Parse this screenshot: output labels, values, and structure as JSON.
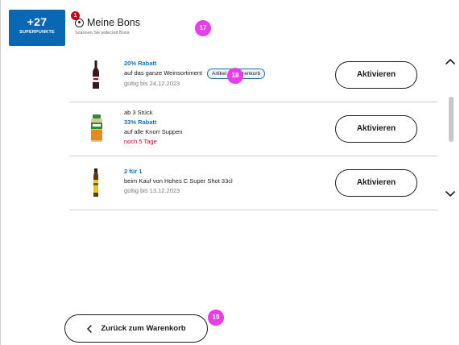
{
  "points_badge": {
    "value": "+27",
    "label": "SUPERPUNKTE"
  },
  "header": {
    "notification_count": "1",
    "title": "Meine Bons",
    "subtitle": "Scannen Sie jederzeit Bons"
  },
  "markers": {
    "header": "17",
    "first_coupon": "18",
    "back": "19"
  },
  "coupons": [
    {
      "pre": "",
      "discount": "20% Rabatt",
      "description": "auf das ganze Weinsortiment",
      "validity": "gültig bis 24.12.2023",
      "cart_tag": "Artikel im Warenkorb",
      "button": "Aktivieren",
      "image_icon": "wine-bottle-icon"
    },
    {
      "pre": "ab 3 Stück",
      "discount": "33% Rabatt",
      "description": "auf alle Knorr Suppen",
      "validity": "noch 5 Tage",
      "button": "Aktivieren",
      "image_icon": "soup-jar-icon"
    },
    {
      "pre": "",
      "discount": "2 für 1",
      "description": "beim Kauf von Hohes C Super Shot 33cl",
      "validity": "gültig bis 13.12.2023",
      "button": "Aktivieren",
      "image_icon": "juice-bottle-icon"
    }
  ],
  "back_button": {
    "label": "Zurück zum Warenkorb"
  },
  "colors": {
    "brand_blue": "#0a67b4",
    "discount_blue": "#1173c6",
    "urgent_red": "#d0021b",
    "marker_magenta": "#e83ee8"
  }
}
